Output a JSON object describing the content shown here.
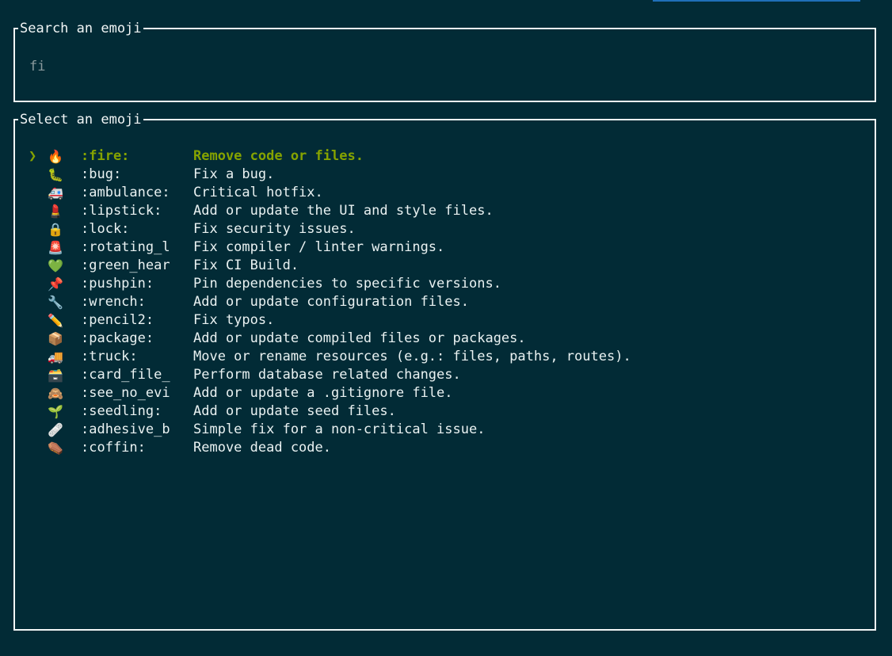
{
  "search": {
    "title": "Search an emoji",
    "query": "fi"
  },
  "select": {
    "title": "Select an emoji",
    "cursor": "❯",
    "selected_index": 0,
    "items": [
      {
        "emoji": "🔥",
        "code": ":fire:",
        "desc": "Remove code or files."
      },
      {
        "emoji": "🐛",
        "code": ":bug:",
        "desc": "Fix a bug."
      },
      {
        "emoji": "🚑",
        "code": ":ambulance:",
        "desc": "Critical hotfix."
      },
      {
        "emoji": "💄",
        "code": ":lipstick:",
        "desc": "Add or update the UI and style files."
      },
      {
        "emoji": "🔒",
        "code": ":lock:",
        "desc": "Fix security issues."
      },
      {
        "emoji": "🚨",
        "code": ":rotating_l",
        "desc": "Fix compiler / linter warnings."
      },
      {
        "emoji": "💚",
        "code": ":green_hear",
        "desc": "Fix CI Build."
      },
      {
        "emoji": "📌",
        "code": ":pushpin:",
        "desc": "Pin dependencies to specific versions."
      },
      {
        "emoji": "🔧",
        "code": ":wrench:",
        "desc": "Add or update configuration files."
      },
      {
        "emoji": "✏️",
        "code": ":pencil2:",
        "desc": "Fix typos."
      },
      {
        "emoji": "📦",
        "code": ":package:",
        "desc": "Add or update compiled files or packages."
      },
      {
        "emoji": "🚚",
        "code": ":truck:",
        "desc": "Move or rename resources (e.g.: files, paths, routes)."
      },
      {
        "emoji": "🗃️",
        "code": ":card_file_",
        "desc": "Perform database related changes."
      },
      {
        "emoji": "🙈",
        "code": ":see_no_evi",
        "desc": "Add or update a .gitignore file."
      },
      {
        "emoji": "🌱",
        "code": ":seedling:",
        "desc": "Add or update seed files."
      },
      {
        "emoji": "🩹",
        "code": ":adhesive_b",
        "desc": "Simple fix for a non-critical issue."
      },
      {
        "emoji": "⚰️",
        "code": ":coffin:",
        "desc": "Remove dead code."
      }
    ]
  },
  "colors": {
    "background": "#022b36",
    "border": "#f2f6f6",
    "accent": "#85a300",
    "muted_text": "#8a9a9d",
    "top_bar": "#1f6fb8"
  }
}
